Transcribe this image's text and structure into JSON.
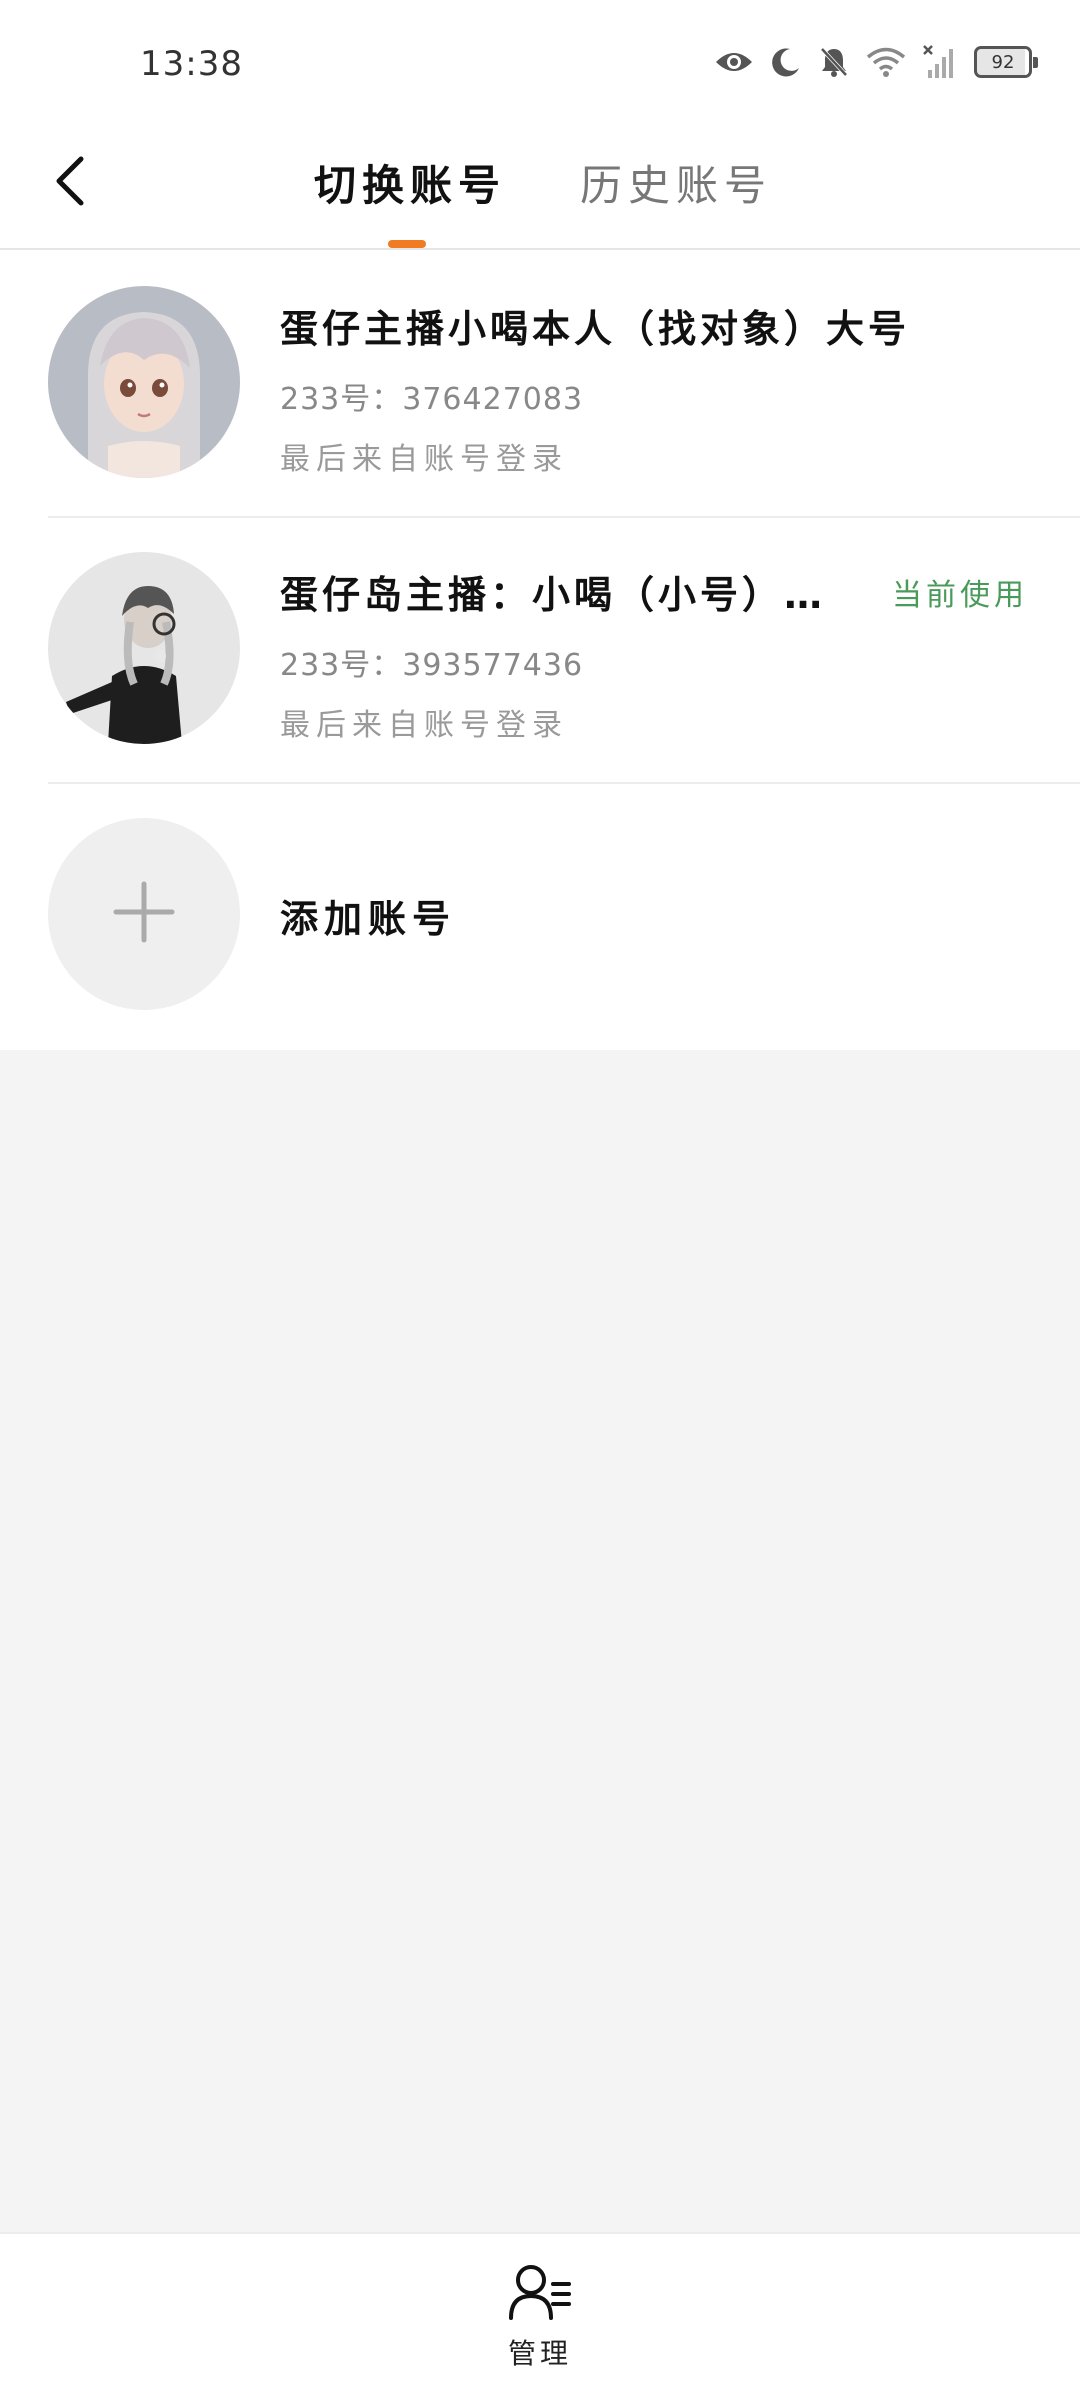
{
  "status_bar": {
    "time": "13:38",
    "battery_level": "92",
    "icons": [
      "eye-icon",
      "moon-icon",
      "bell-muted-icon",
      "wifi-icon",
      "signal-off-icon",
      "battery-icon"
    ]
  },
  "header": {
    "back_icon": "chevron-left-icon",
    "tabs": [
      {
        "label": "切换账号",
        "active": true
      },
      {
        "label": "历史账号",
        "active": false
      }
    ],
    "accent_color": "#f07b22"
  },
  "accounts": [
    {
      "name": "蛋仔主播小喝本人（找对象）大号",
      "id_line": "233号：376427083",
      "login_info": "最后来自账号登录",
      "current": false
    },
    {
      "name": "蛋仔岛主播：小喝（小号）…",
      "id_line": "233号：393577436",
      "login_info": "最后来自账号登录",
      "current": true,
      "current_label": "当前使用",
      "current_color": "#4a9a5a"
    }
  ],
  "add_account": {
    "label": "添加账号",
    "icon": "plus-icon"
  },
  "bottom_bar": {
    "manage_label": "管理",
    "manage_icon": "user-list-icon"
  }
}
